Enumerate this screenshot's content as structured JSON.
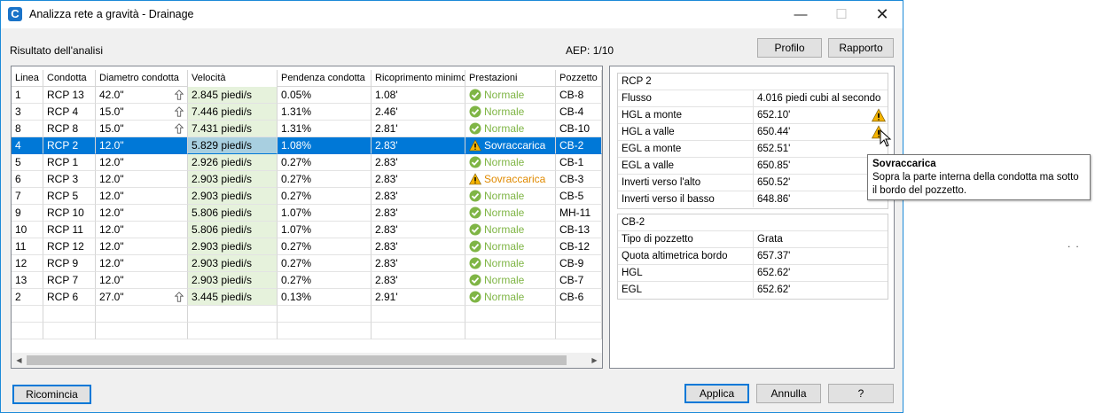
{
  "window": {
    "title": "Analizza rete a gravità - Drainage",
    "app_icon_letter": "C"
  },
  "header": {
    "result_label": "Risultato dell'analisi",
    "aep_label": "AEP:",
    "aep_value": "1/10"
  },
  "toolbar": {
    "profile_button": "Profilo",
    "report_button": "Rapporto"
  },
  "grid": {
    "columns": [
      "Linea",
      "Condotta",
      "Diametro condotta",
      "Velocità",
      "Pendenza condotta",
      "Ricoprimento minimo",
      "Prestazioni",
      "Pozzetto"
    ],
    "rows": [
      {
        "linea": "1",
        "condotta": "RCP 13",
        "diametro": "42.0\"",
        "up": true,
        "velocita": "2.845 piedi/s",
        "pendenza": "0.05%",
        "ricoprimento": "1.08'",
        "stato": "ok",
        "prestazioni": "Normale",
        "pozzetto": "CB-8"
      },
      {
        "linea": "3",
        "condotta": "RCP 4",
        "diametro": "15.0\"",
        "up": true,
        "velocita": "7.446 piedi/s",
        "pendenza": "1.31%",
        "ricoprimento": "2.46'",
        "stato": "ok",
        "prestazioni": "Normale",
        "pozzetto": "CB-4"
      },
      {
        "linea": "8",
        "condotta": "RCP 8",
        "diametro": "15.0\"",
        "up": true,
        "velocita": "7.431 piedi/s",
        "pendenza": "1.31%",
        "ricoprimento": "2.81'",
        "stato": "ok",
        "prestazioni": "Normale",
        "pozzetto": "CB-10"
      },
      {
        "linea": "4",
        "condotta": "RCP 2",
        "diametro": "12.0\"",
        "up": false,
        "velocita": "5.829 piedi/s",
        "pendenza": "1.08%",
        "ricoprimento": "2.83'",
        "stato": "warn",
        "prestazioni": "Sovraccarica",
        "pozzetto": "CB-2",
        "selected": true
      },
      {
        "linea": "5",
        "condotta": "RCP 1",
        "diametro": "12.0\"",
        "up": false,
        "velocita": "2.926 piedi/s",
        "pendenza": "0.27%",
        "ricoprimento": "2.83'",
        "stato": "ok",
        "prestazioni": "Normale",
        "pozzetto": "CB-1"
      },
      {
        "linea": "6",
        "condotta": "RCP 3",
        "diametro": "12.0\"",
        "up": false,
        "velocita": "2.903 piedi/s",
        "pendenza": "0.27%",
        "ricoprimento": "2.83'",
        "stato": "warn",
        "prestazioni": "Sovraccarica",
        "pozzetto": "CB-3"
      },
      {
        "linea": "7",
        "condotta": "RCP 5",
        "diametro": "12.0\"",
        "up": false,
        "velocita": "2.903 piedi/s",
        "pendenza": "0.27%",
        "ricoprimento": "2.83'",
        "stato": "ok",
        "prestazioni": "Normale",
        "pozzetto": "CB-5"
      },
      {
        "linea": "9",
        "condotta": "RCP 10",
        "diametro": "12.0\"",
        "up": false,
        "velocita": "5.806 piedi/s",
        "pendenza": "1.07%",
        "ricoprimento": "2.83'",
        "stato": "ok",
        "prestazioni": "Normale",
        "pozzetto": "MH-11"
      },
      {
        "linea": "10",
        "condotta": "RCP 11",
        "diametro": "12.0\"",
        "up": false,
        "velocita": "5.806 piedi/s",
        "pendenza": "1.07%",
        "ricoprimento": "2.83'",
        "stato": "ok",
        "prestazioni": "Normale",
        "pozzetto": "CB-13"
      },
      {
        "linea": "11",
        "condotta": "RCP 12",
        "diametro": "12.0\"",
        "up": false,
        "velocita": "2.903 piedi/s",
        "pendenza": "0.27%",
        "ricoprimento": "2.83'",
        "stato": "ok",
        "prestazioni": "Normale",
        "pozzetto": "CB-12"
      },
      {
        "linea": "12",
        "condotta": "RCP 9",
        "diametro": "12.0\"",
        "up": false,
        "velocita": "2.903 piedi/s",
        "pendenza": "0.27%",
        "ricoprimento": "2.83'",
        "stato": "ok",
        "prestazioni": "Normale",
        "pozzetto": "CB-9"
      },
      {
        "linea": "13",
        "condotta": "RCP 7",
        "diametro": "12.0\"",
        "up": false,
        "velocita": "2.903 piedi/s",
        "pendenza": "0.27%",
        "ricoprimento": "2.83'",
        "stato": "ok",
        "prestazioni": "Normale",
        "pozzetto": "CB-7"
      },
      {
        "linea": "2",
        "condotta": "RCP 6",
        "diametro": "27.0\"",
        "up": true,
        "velocita": "3.445 piedi/s",
        "pendenza": "0.13%",
        "ricoprimento": "2.91'",
        "stato": "ok",
        "prestazioni": "Normale",
        "pozzetto": "CB-6"
      }
    ]
  },
  "pipe_panel": {
    "title": "RCP 2",
    "rows": [
      {
        "key": "Flusso",
        "value": "4.016 piedi cubi al secondo",
        "warn": false
      },
      {
        "key": "HGL a monte",
        "value": "652.10'",
        "warn": true
      },
      {
        "key": "HGL a valle",
        "value": "650.44'",
        "warn": true
      },
      {
        "key": "EGL a monte",
        "value": "652.51'",
        "warn": false
      },
      {
        "key": "EGL a valle",
        "value": "650.85'",
        "warn": false
      },
      {
        "key": "Inverti verso l'alto",
        "value": "650.52'",
        "warn": false
      },
      {
        "key": "Inverti verso il basso",
        "value": "648.86'",
        "warn": false
      }
    ]
  },
  "structure_panel": {
    "title": "CB-2",
    "rows": [
      {
        "key": "Tipo di pozzetto",
        "value": "Grata"
      },
      {
        "key": "Quota altimetrica bordo",
        "value": "657.37'"
      },
      {
        "key": "HGL",
        "value": "652.62'"
      },
      {
        "key": "EGL",
        "value": "652.62'"
      }
    ]
  },
  "tooltip": {
    "title": "Sovraccarica",
    "text": "Sopra la parte interna della condotta ma sotto il bordo del pozzetto."
  },
  "footer": {
    "reset_button": "Ricomincia",
    "apply_button": "Applica",
    "cancel_button": "Annulla",
    "help_button": "?"
  },
  "colors": {
    "selection": "#0078d7",
    "ok_status": "#7fb545",
    "warn_status": "#e08a00",
    "velocity_bg": "#e6f2dc"
  }
}
